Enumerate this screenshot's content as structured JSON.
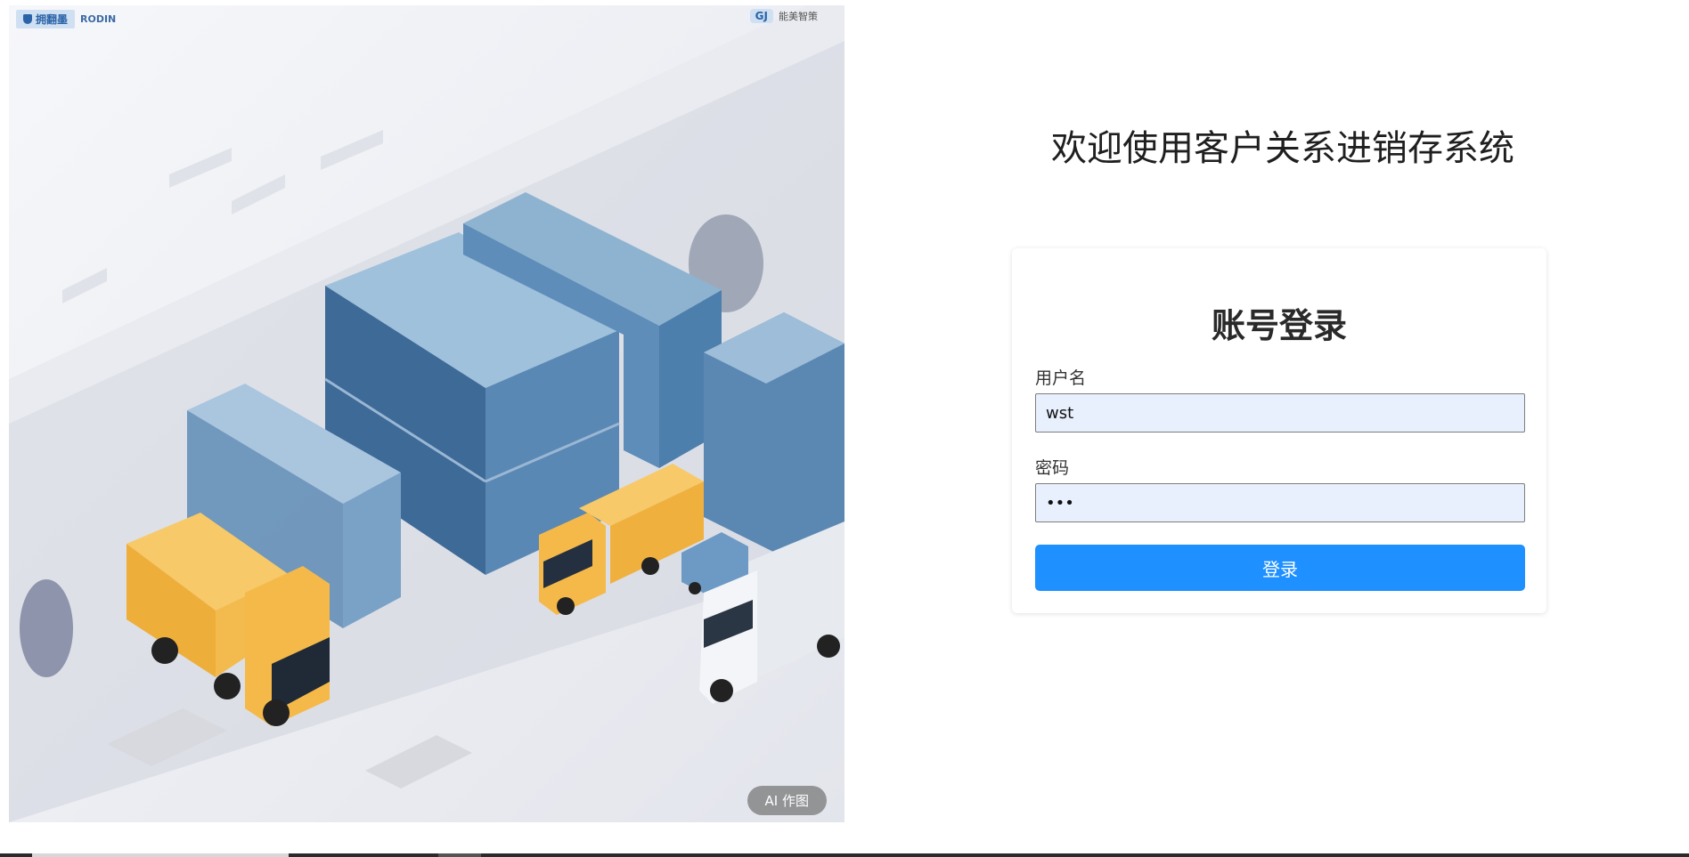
{
  "hero": {
    "logo_left_text": "拥翻墨",
    "logo_left_sub": "RODIN",
    "logo_right_mark": "GJ",
    "logo_right_text": "能美智策",
    "ai_tag": "AI 作图"
  },
  "page": {
    "welcome_title": "欢迎使用客户关系进销存系统"
  },
  "login": {
    "title": "账号登录",
    "username_label": "用户名",
    "username_value": "wst",
    "password_label": "密码",
    "password_value": "•••",
    "submit_label": "登录"
  },
  "colors": {
    "primary": "#1e90ff",
    "input_bg": "#e8f0fe",
    "container_blue": "#4f7fa8",
    "truck_yellow": "#f5b94a"
  }
}
